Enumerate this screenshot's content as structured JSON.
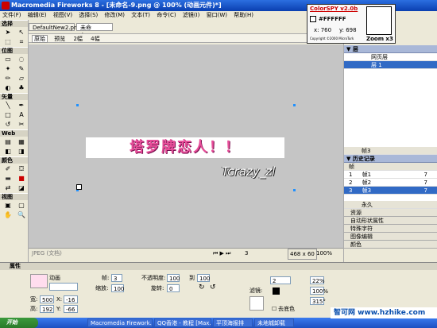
{
  "window": {
    "title": "Macromedia Fireworks 8 - [未命名-9.png @ 100% (动画元件)*]"
  },
  "menu": [
    "文件(F)",
    "编辑(E)",
    "视图(V)",
    "选择(S)",
    "修改(M)",
    "文本(T)",
    "命令(C)",
    "滤镜(I)",
    "窗口(W)",
    "帮助(H)"
  ],
  "tools": {
    "select": "选择",
    "bitmap": "位图",
    "vector": "矢量",
    "web": "Web",
    "colors": "颜色",
    "view": "视图"
  },
  "documents": {
    "tabs": [
      "DefaultNew2.png*",
      "未命名-9.png*"
    ],
    "views": [
      "原始",
      "预览",
      "2幅",
      "4幅"
    ]
  },
  "canvas": {
    "art_text": "塔罗牌恋人！！",
    "signature": "Tcrazy_zl"
  },
  "status": {
    "format": "JPEG (文档)",
    "frame": "3",
    "size": "468 x 60",
    "zoom": "100%"
  },
  "colorspy": {
    "title": "ColorSPY v2.0b",
    "hex": "#FFFFFF",
    "x": "x: 760",
    "y": "y: 698",
    "zoom": "Zoom x3",
    "copyright": "Copyright ©2000 MicroTurk"
  },
  "layers": {
    "items": [
      "网页层",
      "层 1"
    ],
    "frame_label": "帧3"
  },
  "frames": {
    "header": "历史记录",
    "tab": "帧",
    "items": [
      {
        "name": "帧1",
        "delay": "7"
      },
      {
        "name": "帧2",
        "delay": "7"
      },
      {
        "name": "帧3",
        "delay": "7"
      }
    ],
    "loop": "永久"
  },
  "panels": [
    "资源",
    "自动形状属性",
    "特殊字符",
    "图像编辑",
    "颜色"
  ],
  "properties": {
    "header": "属性",
    "kind": "动画",
    "frames_label": "帧:",
    "frames_value": "3",
    "scale_label": "缩放:",
    "scale_value": "100",
    "width_label": "宽:",
    "width_value": "500",
    "height_label": "高:",
    "height_value": "192",
    "x_label": "X:",
    "x_value": "-16",
    "y_label": "Y:",
    "y_value": "-66",
    "opacity_label": "不透明度:",
    "opacity_from": "100",
    "to_label": "到",
    "opacity_to": "100",
    "rotate_label": "旋转:",
    "rotate_value": "0",
    "filters_label": "滤镜:",
    "stroke_value": "2",
    "pct1": "22%",
    "pct2": "100%",
    "deg": "315°",
    "remove_bg": "去底色"
  },
  "taskbar": {
    "start": "开始",
    "items": [
      "Macromedia Firework...",
      "QQ香港 - 教程 [Max...",
      "平顶海报排",
      "未地城卸载"
    ]
  },
  "watermark": "智可网 www.hzhike.com"
}
